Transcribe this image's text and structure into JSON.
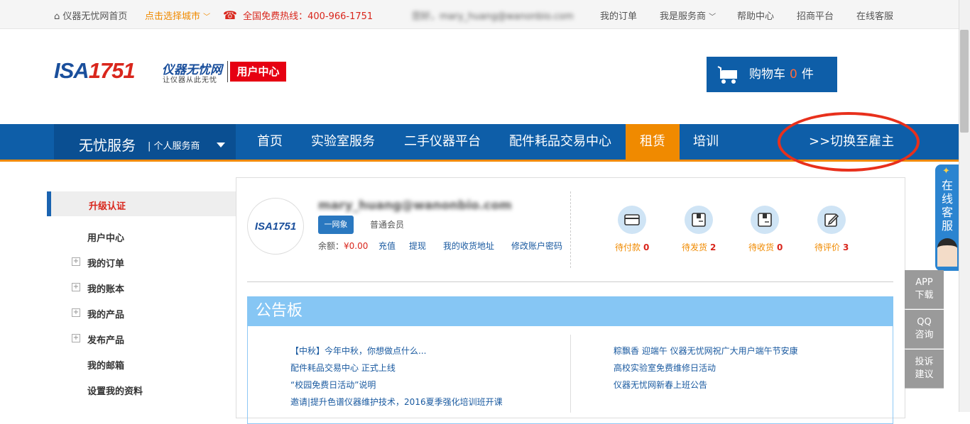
{
  "topbar": {
    "home_label": "仪器无忧网首页",
    "city_label": "点击选择城市",
    "hotline": "全国免费热线：400-966-1751",
    "user_blurred": "您好，mary_huang@wanonbio.com",
    "orders": "我的订单",
    "provider": "我是服务商",
    "help": "帮助中心",
    "merchants": "招商平台",
    "service": "在线客服"
  },
  "header": {
    "logo_text": "ISA",
    "logo_num": "1751",
    "logo_cn": "仪器无忧网",
    "logo_sub": "让仪器从此无忧",
    "user_center": "用户中心",
    "cart_label": "购物车",
    "cart_count": "0",
    "cart_unit": "件"
  },
  "nav": {
    "service": "无忧服务",
    "service_type": "| 个人服务商",
    "items": [
      "首页",
      "实验室服务",
      "二手仪器平台",
      "配件耗品交易中心",
      "租赁",
      "培训"
    ],
    "switch": ">>切换至雇主"
  },
  "sidebar": {
    "active": "升级认证",
    "items": [
      "用户中心",
      "我的订单",
      "我的账本",
      "我的产品",
      "发布产品",
      "我的邮箱",
      "设置我的资料"
    ]
  },
  "profile": {
    "avatar_text": "ISA1751",
    "email": "mary_huang@wanonbio.com",
    "badge": "一网象",
    "member": "普通会员",
    "balance_label": "余额：",
    "balance_value": "¥0.00",
    "links": [
      "充值",
      "提现",
      "我的收货地址",
      "修改账户密码"
    ]
  },
  "orders": [
    {
      "label": "待付款",
      "count": "0",
      "icon": "card-icon"
    },
    {
      "label": "待发货",
      "count": "2",
      "icon": "box-icon"
    },
    {
      "label": "待收货",
      "count": "0",
      "icon": "package-icon"
    },
    {
      "label": "待评价",
      "count": "3",
      "icon": "edit-icon"
    }
  ],
  "notice": {
    "title": "公告板",
    "left": [
      "【中秋】今年中秋，你想做点什么...",
      "配件耗品交易中心 正式上线",
      "“校园免费日活动”说明",
      "邀请|提升色谱仪器维护技术，2016夏季强化培训班开课"
    ],
    "right": [
      "粽飘香 迎端午 仪器无忧网祝广大用户端午节安康",
      "高校实验室免费维修日活动",
      "仪器无忧网新春上班公告"
    ]
  },
  "float": {
    "online": "在线客服",
    "app": "APP下载",
    "qq": "QQ咨询",
    "complain": "投诉建议"
  },
  "colors": {
    "brand_blue": "#0e5ea8",
    "accent_orange": "#f08a00",
    "red": "#d9261c"
  }
}
